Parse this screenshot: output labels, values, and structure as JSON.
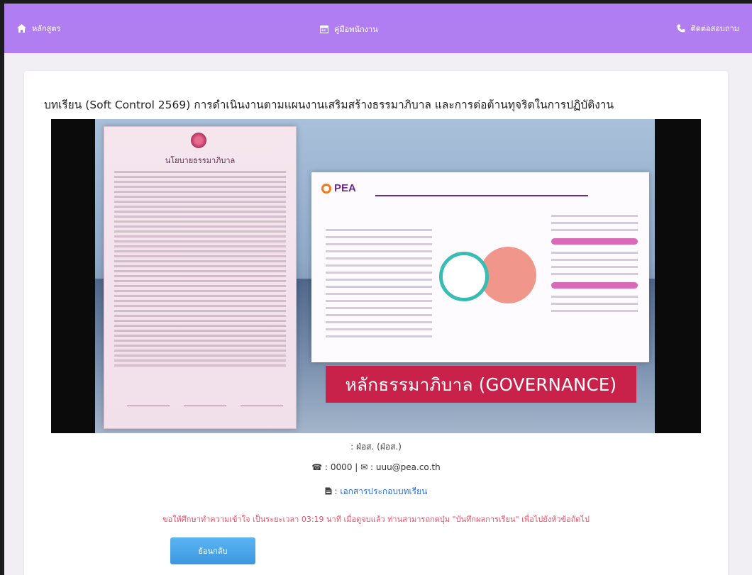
{
  "nav": {
    "home_label": "หลักสูตร",
    "manual_label": "คู่มือพนักงาน",
    "contact_label": "ติดต่อสอบถาม"
  },
  "lesson": {
    "title": "บทเรียน (Soft Control 2569) การดำเนินงานตามแผนงานเสริมสร้างธรรมาภิบาล และการต่อต้านทุจริตในการปฏิบัติงาน"
  },
  "video": {
    "left_doc_heading": "นโยบายธรรมาภิบาล",
    "slide_logo": "PEA",
    "banner_text": "หลักธรรมาภิบาล (GOVERNANCE)"
  },
  "meta": {
    "author": ": ฝ่อส. (ฝ่อส.)",
    "contact": "☎ : 0000 | ✉ : uuu@pea.co.th",
    "doc_prefix": ": ",
    "doc_link": "เอกสารประกอบบทเรียน",
    "notice": "ขอให้ศึกษาทำความเข้าใจ เป็นระยะเวลา 03:19 นาที เมื่อดูจบแล้ว ท่านสามารถกดปุ่ม \"บันทึกผลการเรียน\" เพื่อไปยังหัวข้อถัดไป"
  },
  "buttons": {
    "back_label": "ย้อนกลับ"
  },
  "colors": {
    "topbar": "#b07ef0",
    "banner": "#c8214a",
    "notice": "#e5546c",
    "button": "#3d97e0",
    "link": "#2f6fd0"
  },
  "icons": {
    "home": "home-icon",
    "manual": "calendar-icon",
    "contact": "phone-icon",
    "document": "document-icon"
  }
}
